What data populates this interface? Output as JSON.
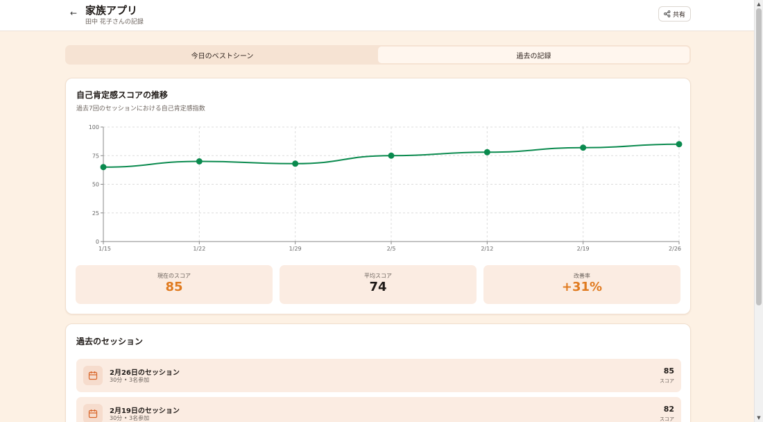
{
  "header": {
    "title": "家族アプリ",
    "subtitle": "田中 花子さんの記録",
    "share_label": "共有"
  },
  "tabs": [
    {
      "label": "今日のベストシーン",
      "active": false
    },
    {
      "label": "過去の記録",
      "active": true
    }
  ],
  "chart_card": {
    "title": "自己肯定感スコアの推移",
    "subtitle": "過去7回のセッションにおける自己肯定感指数"
  },
  "chart_data": {
    "type": "line",
    "title": "自己肯定感スコアの推移",
    "xlabel": "",
    "ylabel": "",
    "categories": [
      "1/15",
      "1/22",
      "1/29",
      "2/5",
      "2/12",
      "2/19",
      "2/26"
    ],
    "series": [
      {
        "values": [
          65,
          70,
          68,
          75,
          78,
          82,
          85
        ],
        "color": "#0a8a4e"
      }
    ],
    "ylim": [
      0,
      100
    ],
    "yticks": [
      0,
      25,
      50,
      75,
      100
    ],
    "grid": true
  },
  "stats": [
    {
      "label": "現在のスコア",
      "value": "85",
      "color": "#e07a1f"
    },
    {
      "label": "平均スコア",
      "value": "74",
      "color": "#1f1a17"
    },
    {
      "label": "改善率",
      "value": "+31%",
      "color": "#e07a1f"
    }
  ],
  "sessions": {
    "title": "過去のセッション",
    "items": [
      {
        "title": "2月26日のセッション",
        "meta": "30分 • 3名参加",
        "score": "85",
        "score_label": "スコア"
      },
      {
        "title": "2月19日のセッション",
        "meta": "30分 • 3名参加",
        "score": "82",
        "score_label": "スコア"
      }
    ]
  },
  "colors": {
    "background": "#fdf1e4",
    "accent": "#e07a1f",
    "line": "#0a8a4e",
    "icon": "#d9662a"
  }
}
